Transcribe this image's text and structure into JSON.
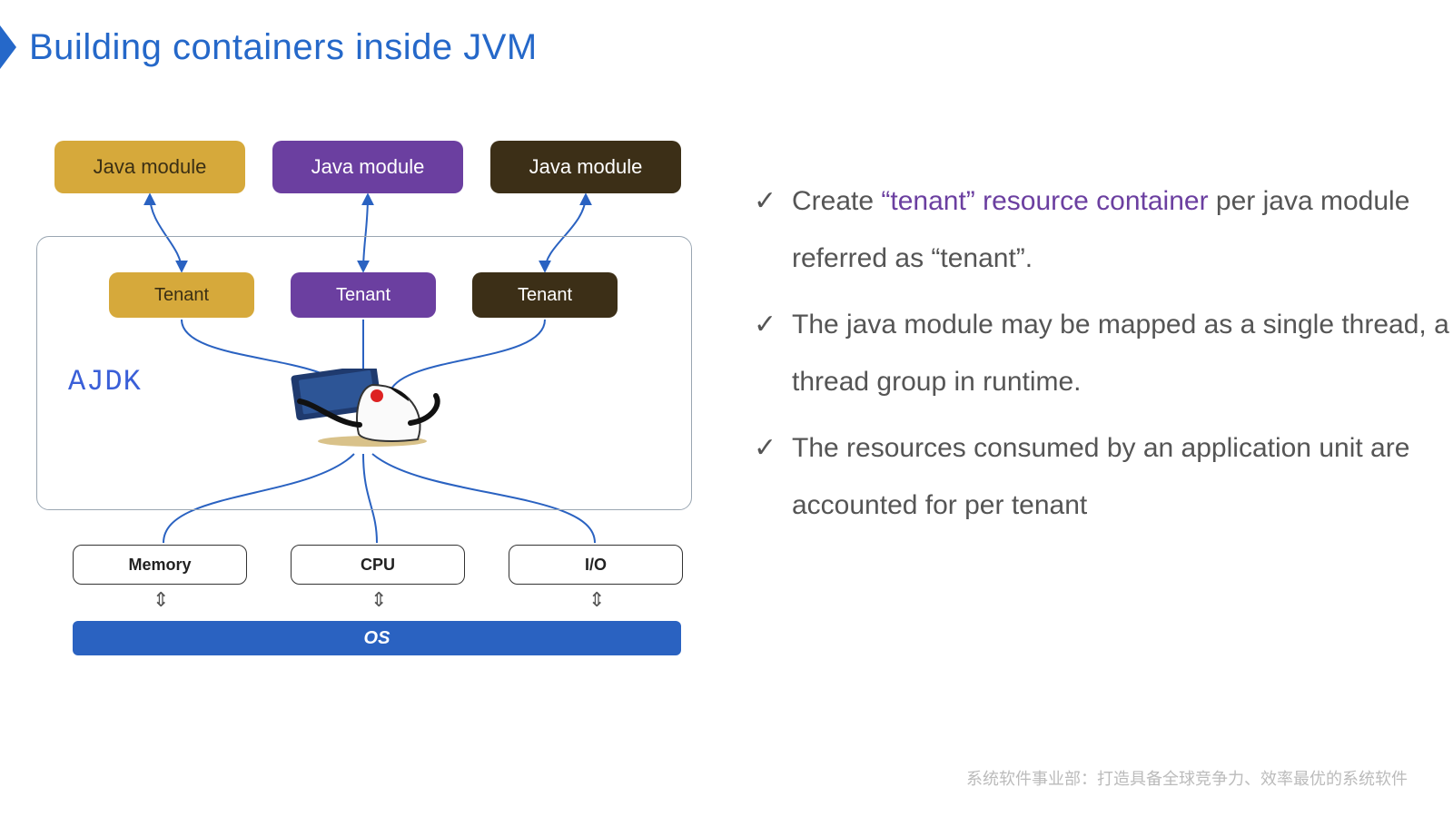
{
  "title": "Building containers inside JVM",
  "modules": [
    "Java module",
    "Java module",
    "Java module"
  ],
  "tenants": [
    "Tenant",
    "Tenant",
    "Tenant"
  ],
  "ajdk": "AJDK",
  "resources": [
    "Memory",
    "CPU",
    "I/O"
  ],
  "os": "OS",
  "bullets": [
    {
      "pre": "Create ",
      "hl": "“tenant” resource container",
      "post": " per java module referred as  “tenant”."
    },
    {
      "pre": "The java module may be mapped as a single thread, a thread group in runtime.",
      "hl": "",
      "post": ""
    },
    {
      "pre": "The resources consumed by an application unit are accounted for per tenant",
      "hl": "",
      "post": ""
    }
  ],
  "footer": "系统软件事业部：打造具备全球竞争力、效率最优的系统软件"
}
